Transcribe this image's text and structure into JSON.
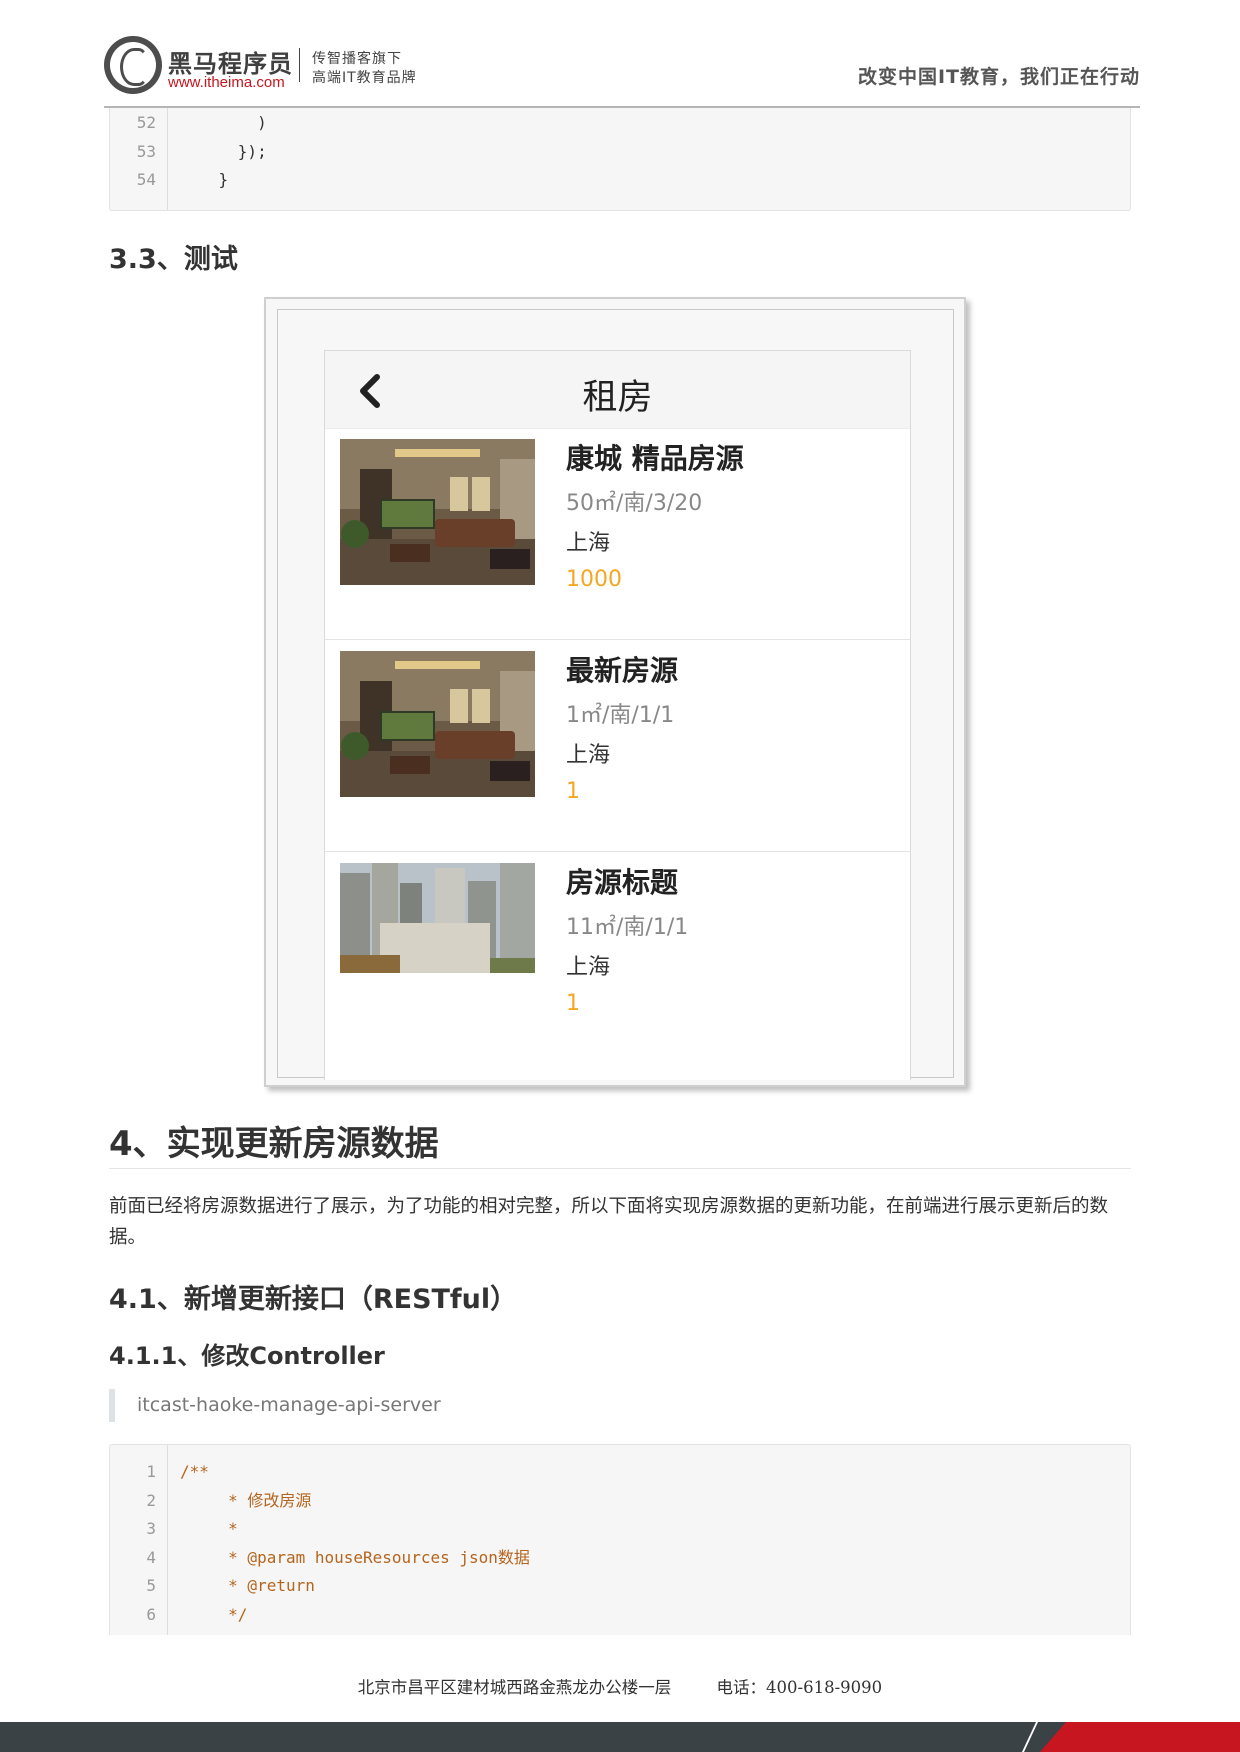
{
  "header": {
    "logo_name": "黑马程序员",
    "logo_url": "www.itheima.com",
    "logo_tag_line1": "传智播客旗下",
    "logo_tag_line2": "高端IT教育品牌",
    "slogan": "改变中国IT教育，我们正在行动"
  },
  "code_block_1": {
    "lines": [
      {
        "num": "52",
        "text": "        )"
      },
      {
        "num": "53",
        "text": "      });"
      },
      {
        "num": "54",
        "text": "    }"
      }
    ]
  },
  "section_3_3": {
    "heading": "3.3、测试"
  },
  "screenshot": {
    "nav_title": "租房",
    "houses": [
      {
        "title": "康城 精品房源",
        "desc": "50㎡/南/3/20",
        "city": "上海",
        "price": "1000",
        "image": "living-room"
      },
      {
        "title": "最新房源",
        "desc": "1㎡/南/1/1",
        "city": "上海",
        "price": "1",
        "image": "living-room"
      },
      {
        "title": "房源标题",
        "desc": "11㎡/南/1/1",
        "city": "上海",
        "price": "1",
        "image": "city-buildings"
      }
    ]
  },
  "section_4": {
    "heading": "4、实现更新房源数据",
    "paragraph": "前面已经将房源数据进行了展示，为了功能的相对完整，所以下面将实现房源数据的更新功能，在前端进行展示更新后的数据。"
  },
  "section_4_1": {
    "heading": "4.1、新增更新接口（RESTful）"
  },
  "section_4_1_1": {
    "heading": "4.1.1、修改Controller",
    "quote": "itcast-haoke-manage-api-server"
  },
  "code_block_2": {
    "lines": [
      {
        "num": "1",
        "text": "/**"
      },
      {
        "num": "2",
        "text": "     * 修改房源"
      },
      {
        "num": "3",
        "text": "     *"
      },
      {
        "num": "4",
        "text": "     * @param houseResources json数据"
      },
      {
        "num": "5",
        "text": "     * @return"
      },
      {
        "num": "6",
        "text": "     */"
      }
    ]
  },
  "footer": {
    "address": "北京市昌平区建材城西路金燕龙办公楼一层",
    "phone": "电话：400-618-9090"
  },
  "colors": {
    "price_accent": "#f5a623",
    "brand_red": "#c7161f",
    "code_comment": "#b5651d",
    "footer_bar": "#3b4246"
  }
}
